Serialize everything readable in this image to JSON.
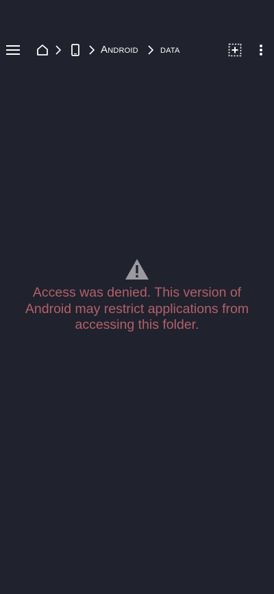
{
  "toolbar": {
    "menu_icon": "hamburger-menu-icon",
    "home_icon": "home-icon",
    "device_icon": "phone-icon",
    "separator_icon": "chevron-right-icon",
    "breadcrumbs": [
      {
        "label": "Android"
      },
      {
        "label": "data"
      }
    ],
    "select_icon": "select-all-icon",
    "overflow_icon": "more-vert-icon"
  },
  "error": {
    "icon": "warning-icon",
    "message": "Access was denied. This version of Android may restrict applications from accessing this folder."
  },
  "colors": {
    "background": "#20222d",
    "error_text": "#b2606b",
    "icon": "#ffffff",
    "warning_icon": "#9a9aa0"
  }
}
